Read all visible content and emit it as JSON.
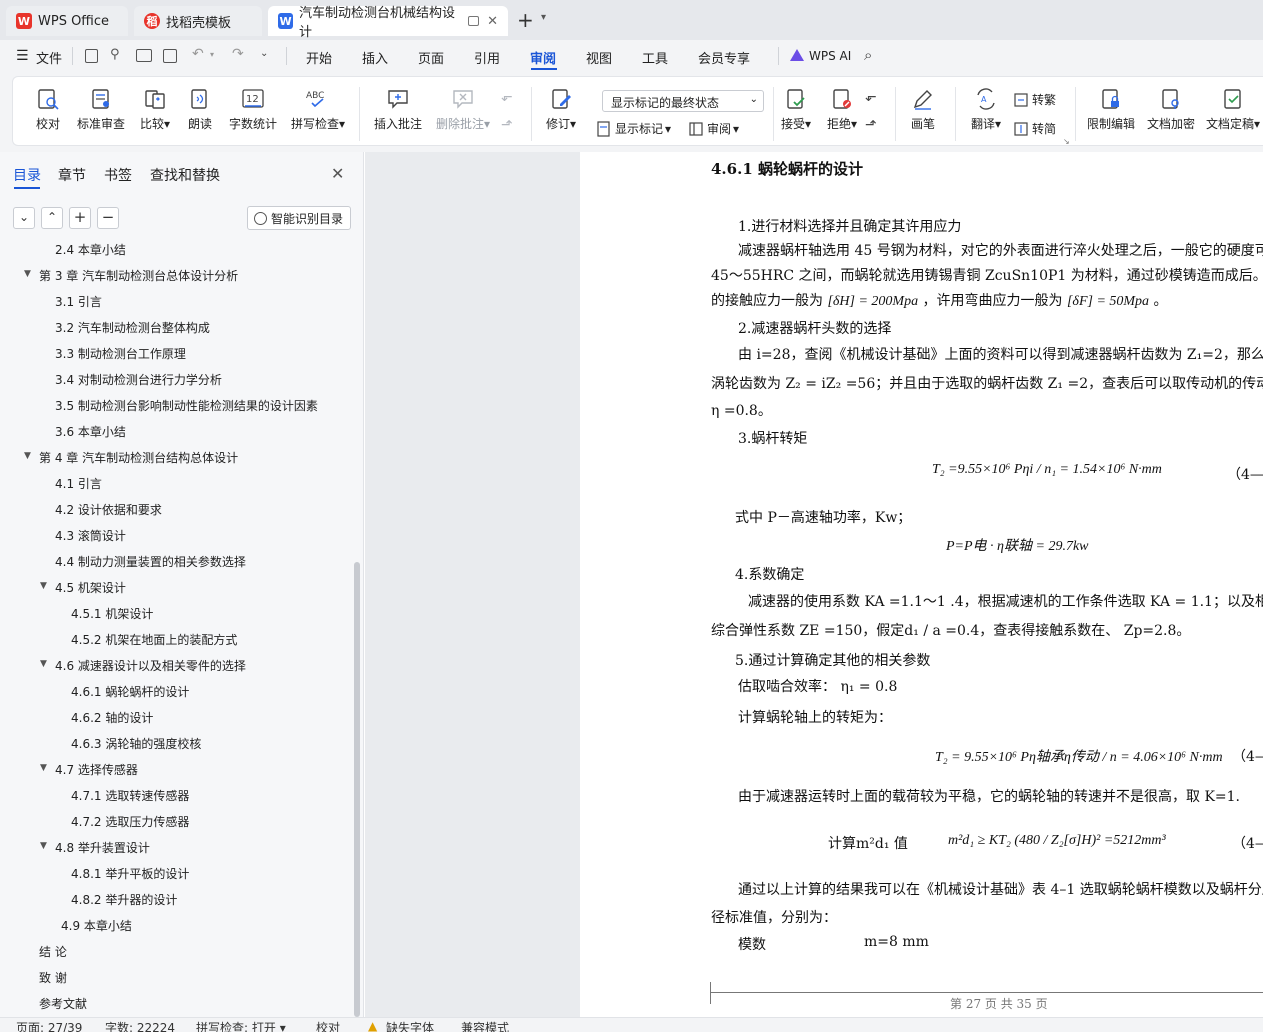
{
  "titlebar": {
    "tabs": [
      {
        "label": "WPS Office",
        "logo": "W"
      },
      {
        "label": "找稻壳模板",
        "logo": "稻"
      },
      {
        "label": "汽车制动检测台机械结构设计",
        "logo": "W"
      }
    ],
    "new_tab": "+",
    "close": "✕"
  },
  "menubar": {
    "file": "文件",
    "items": [
      "开始",
      "插入",
      "页面",
      "引用",
      "审阅",
      "视图",
      "工具",
      "会员专享"
    ],
    "active": "审阅",
    "wps_ai": "WPS AI"
  },
  "ribbon": {
    "proofread": "校对",
    "standard_review": "标准审查",
    "compare": "比较",
    "read_aloud": "朗读",
    "word_count": "字数统计",
    "spell_check": "拼写检查",
    "spell_icon_text": "ABC",
    "count_icon_text": "12",
    "insert_comment": "插入批注",
    "delete_comment": "删除批注",
    "track_changes": "修订",
    "markup_state": "显示标记的最终状态",
    "show_markup": "显示标记",
    "review": "审阅",
    "accept": "接受",
    "reject": "拒绝",
    "pen": "画笔",
    "translate": "翻译",
    "to_traditional": "转繁",
    "to_simplified": "转简",
    "restrict_edit": "限制编辑",
    "encrypt": "文档加密",
    "finalize": "文档定稿"
  },
  "sidepanel": {
    "tabs": [
      "目录",
      "章节",
      "书签",
      "查找和替换"
    ],
    "smart_toc": "智能识别目录",
    "toc": [
      {
        "text": "2.4  本章小结",
        "level": 2
      },
      {
        "text": "第 3 章   汽车制动检测台总体设计分析",
        "level": 1,
        "arrow": true
      },
      {
        "text": "3.1  引言",
        "level": 2
      },
      {
        "text": "3.2 汽车制动检测台整体构成",
        "level": 2
      },
      {
        "text": "3.3  制动检测台工作原理",
        "level": 2
      },
      {
        "text": "3.4  对制动检测台进行力学分析",
        "level": 2
      },
      {
        "text": "3.5  制动检测台影响制动性能检测结果的设计因素",
        "level": 2
      },
      {
        "text": "3.6  本章小结",
        "level": 2
      },
      {
        "text": "第 4 章  汽车制动检测台结构总体设计",
        "level": 1,
        "arrow": true
      },
      {
        "text": "4.1  引言",
        "level": 2
      },
      {
        "text": "4.2  设计依据和要求",
        "level": 2
      },
      {
        "text": "4.3  滚筒设计",
        "level": 2
      },
      {
        "text": "4.4  制动力测量装置的相关参数选择",
        "level": 2
      },
      {
        "text": "4.5  机架设计",
        "level": 2,
        "arrow": true
      },
      {
        "text": "4.5.1 机架设计",
        "level": 3
      },
      {
        "text": "4.5.2 机架在地面上的装配方式",
        "level": 3
      },
      {
        "text": "4.6  减速器设计以及相关零件的选择",
        "level": 2,
        "arrow": true
      },
      {
        "text": "4.6.1  蜗轮蜗杆的设计",
        "level": 3
      },
      {
        "text": "4.6.2  轴的设计",
        "level": 3
      },
      {
        "text": "4.6.3 涡轮轴的强度校核",
        "level": 3
      },
      {
        "text": "4.7  选择传感器",
        "level": 2,
        "arrow": true
      },
      {
        "text": "4.7.1  选取转速传感器",
        "level": 3
      },
      {
        "text": "4.7.2  选取压力传感器",
        "level": 3
      },
      {
        "text": "4.8  举升装置设计",
        "level": 2,
        "arrow": true
      },
      {
        "text": "4.8.1  举升平板的设计",
        "level": 3
      },
      {
        "text": "4.8.2  举升器的设计",
        "level": 3
      },
      {
        "text": "4.9  本章小结",
        "level": 2,
        "extra": true
      },
      {
        "text": "结      论",
        "level": 1
      },
      {
        "text": "致      谢",
        "level": 1
      },
      {
        "text": "参考文献",
        "level": 1
      }
    ]
  },
  "document": {
    "heading": "4.6.1  蜗轮蜗杆的设计",
    "p1": "1.进行材料选择并且确定其许用应力",
    "p2": "减速器蜗杆轴选用 45 号钢为材料，对它的外表面进行淬火处理之后，一般它的硬度可",
    "p3": "45～55HRC 之间，而蜗轮就选用铸锡青铜 ZcuSn10P1 为材料，通过砂模铸造而成后。它的",
    "p4a": "的接触应力一般为",
    "p4b": "[δH] = 200Mpa",
    "p4c": "，许用弯曲应力一般为",
    "p4d": "[δF] = 50Mpa",
    "p4e": "。",
    "p5": "2.减速器蜗杆头数的选择",
    "p6": "由 i=28，查阅《机械设计基础》上面的资料可以得到减速器蜗杆齿数为 Z₁=2，那么减",
    "p7": "涡轮齿数为 Z₂ = iZ₂ =56；并且由于选取的蜗杆齿数 Z₁ =2，查表后可以取传动机的传动",
    "p8": "η =0.8。",
    "p9": "3.蜗杆转矩",
    "eq1": "T₂ =9.55×10⁶ Pηi / n₁ = 1.54×10⁶  N·mm",
    "eq1_no": "（4—",
    "p10": "式中 P－高速轴功率，Kw；",
    "eq2": "P=P电 · η联轴 = 29.7kw",
    "p11": "4.系数确定",
    "p12": "减速器的使用系数 KA =1.1～1 .4，根据减速机的工作条件选取 KA = 1.1；以及相关的",
    "p13": "综合弹性系数 ZE =150，假定d₁ / a =0.4，查表得接触系数在、 Zp=2.8。",
    "p14": "5.通过计算确定其他的相关参数",
    "p15": "估取啮合效率：    η₁ = 0.8",
    "p16": "计算蜗轮轴上的转矩为：",
    "eq3": "T₂ = 9.55×10⁶ Pη轴承η传动 / n = 4.06×10⁶ N·mm",
    "eq3_no": "（4—",
    "p17": "由于减速器运转时上面的载荷较为平稳，它的蜗轮轴的转速并不是很高，取 K=1.",
    "eq4_label": "计算m²d₁ 值",
    "eq4": "m²d₁ ≥ KT₂ (480 / Z₂[σ]H)² =5212mm³",
    "eq4_no": "（4—",
    "p18": "通过以上计算的结果我可以在《机械设计基础》表 4–1 选取蜗轮蜗杆模数以及蜗杆分度",
    "p19": "径标准值，分别为：",
    "p20a": "模数",
    "p20b": "m=8 mm",
    "footer": "第 27 页 共 35 页"
  },
  "statusbar": {
    "page": "页面: 27/39",
    "words": "字数: 22224",
    "spell": "拼写检查: 打开",
    "proof": "校对",
    "missing_font": "缺失字体",
    "compat": "兼容模式"
  }
}
